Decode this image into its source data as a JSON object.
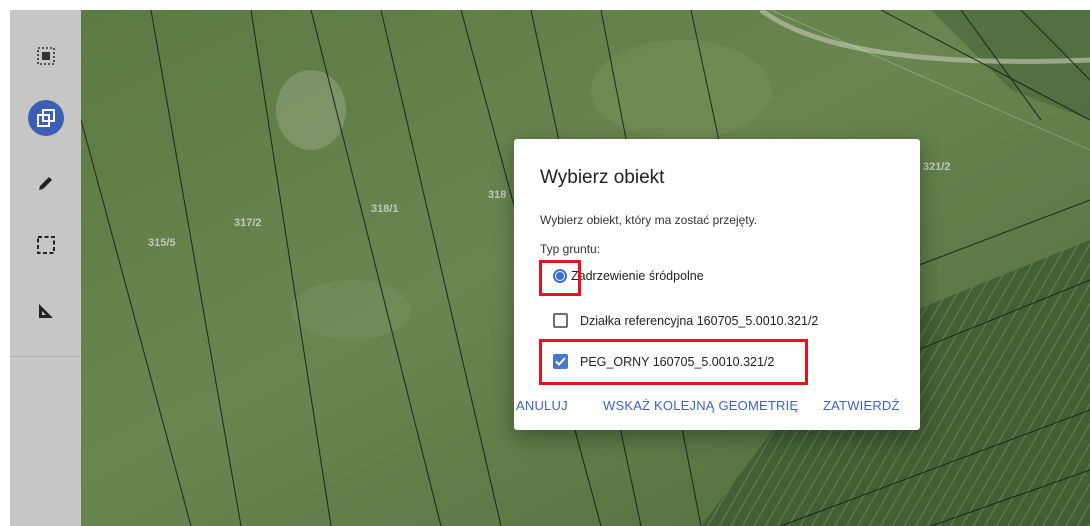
{
  "toolbar": {
    "tools": [
      {
        "name": "select-area-icon",
        "active": false
      },
      {
        "name": "copy-object-icon",
        "active": true
      },
      {
        "name": "pencil-icon",
        "active": false
      },
      {
        "name": "rectangle-select-icon",
        "active": false
      },
      {
        "name": "measure-icon",
        "active": false
      }
    ]
  },
  "map": {
    "parcel_labels": [
      "315/5",
      "317/2",
      "318/1",
      "318",
      "321/2"
    ]
  },
  "dialog": {
    "title": "Wybierz obiekt",
    "subtitle": "Wybierz obiekt, który ma zostać przejęty.",
    "type_label": "Typ gruntu:",
    "options": [
      {
        "label": "Zadrzewienie śródpolne",
        "control": "radio",
        "selected": true
      },
      {
        "label": "Działka referencyjna 160705_5.0010.321/2",
        "control": "checkbox",
        "checked": false
      },
      {
        "label": "PEG_ORNY 160705_5.0010.321/2",
        "control": "checkbox",
        "checked": true
      }
    ],
    "actions": {
      "cancel": "ANULUJ",
      "next_geometry": "WSKAŻ KOLEJNĄ GEOMETRIĘ",
      "confirm": "ZATWIERDŹ"
    }
  },
  "colors": {
    "accent": "#3a6fd8",
    "highlight": "#e5141c",
    "toolbar_bg": "#c6c6c6"
  }
}
